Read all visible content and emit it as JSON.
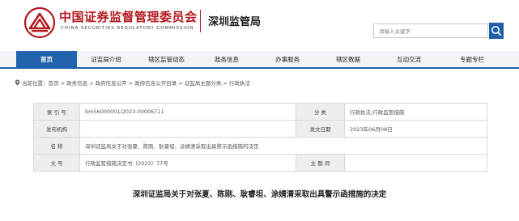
{
  "header": {
    "org_name_cn": "中国证券监督管理委员会",
    "org_name_en": "CHINA SECURITIES REGULATORY COMMISSION",
    "branch_name": "深圳监管局",
    "logo_icon": "csrc-emblem-icon",
    "brand_color": "#b3171c"
  },
  "search": {
    "placeholder": "请输入关键字",
    "button_icon": "search-icon",
    "button_color": "#1f5fa8"
  },
  "nav": {
    "accent_color": "#2163ad",
    "items": [
      {
        "label": "首页",
        "active": true
      },
      {
        "label": "证监局介绍",
        "active": false
      },
      {
        "label": "辖区监管动态",
        "active": false
      },
      {
        "label": "政务信息",
        "active": false
      },
      {
        "label": "办事服务",
        "active": false
      },
      {
        "label": "辖区数据",
        "active": false
      },
      {
        "label": "互动交流",
        "active": false
      },
      {
        "label": "专题专栏",
        "active": false
      }
    ]
  },
  "breadcrumb": {
    "icon": "location-pin-icon",
    "text": "当前位置：首页 > 政务信息 > 政府信息公开 > 政府信息公开目录 > 证监局主题分类 > 行政执法"
  },
  "meta": {
    "index_label": "索 引 号",
    "index_value": "bm56000001/2023-00006711",
    "category_label": "分 类",
    "category_value": "行政执法;行政监管措施",
    "publisher_label": "发布机构",
    "publisher_value": "",
    "date_label": "发文日期",
    "date_value": "2023年06月08日",
    "name_label": "名 称",
    "name_value": "深圳证监局关于对张夏、陈刚、耿睿坦、涂婧清采取出具警示函措施的决定",
    "doc_no_label": "文 号",
    "doc_no_value": "行政监管措施决定书〔2023〕77号",
    "keywords_label": "主 题 词",
    "keywords_value": ""
  },
  "document": {
    "title": "深圳证监局关于对张夏、陈刚、耿睿坦、涂婧清采取出具警示函措施的决定"
  }
}
